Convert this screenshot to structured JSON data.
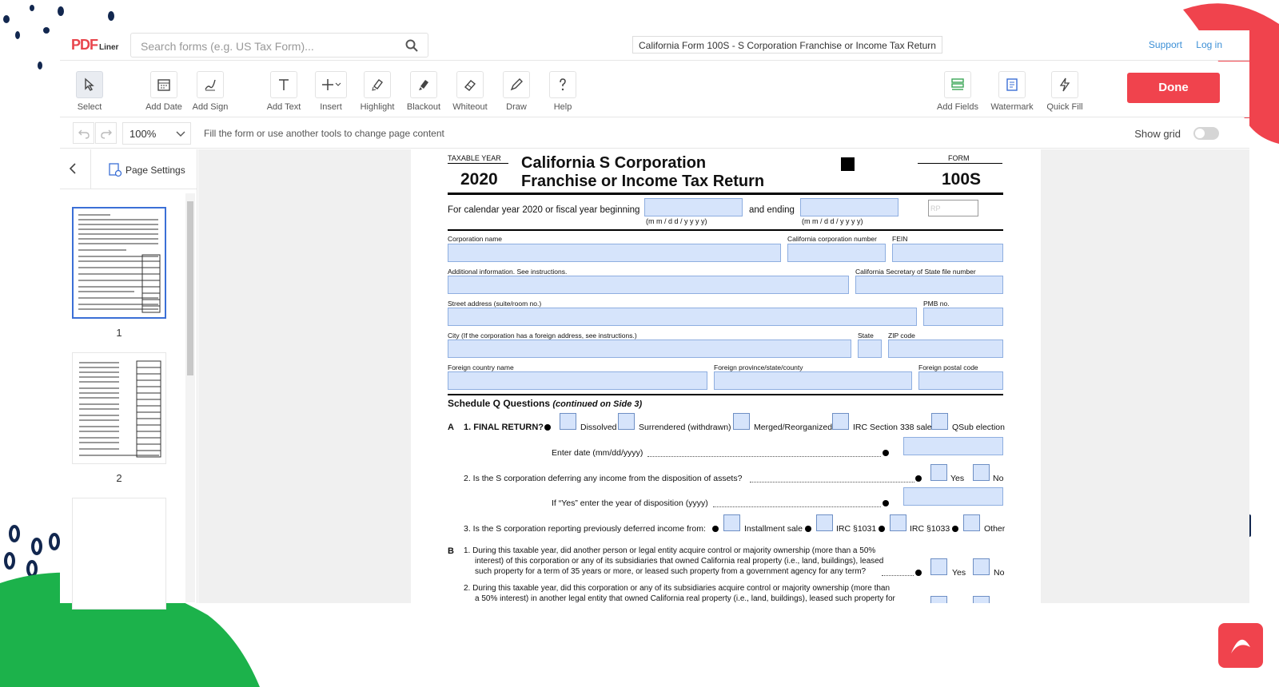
{
  "app": {
    "logo": "PDF",
    "logo_sub": "Liner"
  },
  "search": {
    "placeholder": "Search forms (e.g. US Tax Form)..."
  },
  "document_title": "California Form 100S - S Corporation Franchise or Income Tax Return",
  "top_links": {
    "support": "Support",
    "login": "Log in"
  },
  "toolbar": {
    "tools": [
      {
        "label": "Select",
        "icon": "cursor-icon"
      },
      {
        "label": "Add Date",
        "icon": "calendar-icon"
      },
      {
        "label": "Add Sign",
        "icon": "signature-icon"
      },
      {
        "label": "Add Text",
        "icon": "text-icon"
      },
      {
        "label": "Insert",
        "icon": "plus-icon"
      },
      {
        "label": "Highlight",
        "icon": "highlighter-icon"
      },
      {
        "label": "Blackout",
        "icon": "blackout-icon"
      },
      {
        "label": "Whiteout",
        "icon": "eraser-icon"
      },
      {
        "label": "Draw",
        "icon": "pen-icon"
      },
      {
        "label": "Help",
        "icon": "question-icon"
      }
    ],
    "right_tools": [
      {
        "label": "Add Fields",
        "icon": "fields-icon"
      },
      {
        "label": "Watermark",
        "icon": "watermark-icon"
      },
      {
        "label": "Quick Fill",
        "icon": "lightning-icon"
      }
    ],
    "done": "Done"
  },
  "subbar": {
    "zoom": "100%",
    "hint": "Fill the form or use another tools to change page content",
    "show_grid": "Show grid"
  },
  "sidebar": {
    "page_settings": "Page Settings",
    "pages": [
      "1",
      "2"
    ]
  },
  "form": {
    "taxable_year_label": "TAXABLE YEAR",
    "year": "2020",
    "title_line1": "California S Corporation",
    "title_line2": "Franchise or Income Tax Return",
    "form_label": "FORM",
    "form_number": "100S",
    "calendar_text": "For calendar year 2020 or fiscal year beginning",
    "date_hint": "(m m / d  d / y  y  y  y)",
    "and_ending": "and ending",
    "rp": "RP",
    "corp_name": "Corporation name",
    "ca_corp_number": "California corporation number",
    "fein": "FEIN",
    "additional_info": "Additional information. See instructions.",
    "sos_file_number": "California Secretary of State file number",
    "street": "Street address (suite/room no.)",
    "pmb": "PMB no.",
    "city": "City (If the corporation has a foreign address, see instructions.)",
    "state": "State",
    "zip": "ZIP code",
    "foreign_country": "Foreign country name",
    "foreign_province": "Foreign province/state/county",
    "foreign_postal": "Foreign postal code",
    "schedule_q": "Schedule Q Questions",
    "schedule_q_cont": "(continued on Side 3)",
    "a_letter": "A",
    "a1": "1.  FINAL RETURN?",
    "opt_dissolved": "Dissolved",
    "opt_surrendered": "Surrendered (withdrawn)",
    "opt_merged": "Merged/Reorganized",
    "opt_irc338": "IRC Section 338 sale",
    "opt_qsub": "QSub election",
    "enter_date": "Enter date (mm/dd/yyyy)",
    "a2": "2.  Is the S corporation deferring any income from the disposition of assets?",
    "yes": "Yes",
    "no": "No",
    "if_yes": "If “Yes” enter the year of disposition (yyyy)",
    "a3": "3.  Is the S corporation reporting previously deferred income from:",
    "opt_installment": "Installment sale",
    "opt_irc1031": "IRC §1031",
    "opt_irc1033": "IRC §1033",
    "opt_other": "Other",
    "b_letter": "B",
    "b1_line1": "1.  During this taxable year, did another person or legal entity acquire control or majority ownership (more than a 50%",
    "b1_line2": "interest) of this corporation or any of its subsidiaries that owned California real property (i.e., land, buildings), leased",
    "b1_line3": "such property for a term of 35 years or more, or leased such property from a government agency for any term?",
    "b2_line1": "2.  During this taxable year, did this corporation or any of its subsidiaries acquire control or majority ownership (more than",
    "b2_line2": "a 50% interest) in another legal entity that owned California real property (i.e., land, buildings), leased such property for"
  },
  "colors": {
    "accent": "#f0434d",
    "link": "#3b8fd6",
    "field": "#d6e4fb",
    "deco_green": "#1cb24b",
    "deco_navy": "#12274f"
  }
}
